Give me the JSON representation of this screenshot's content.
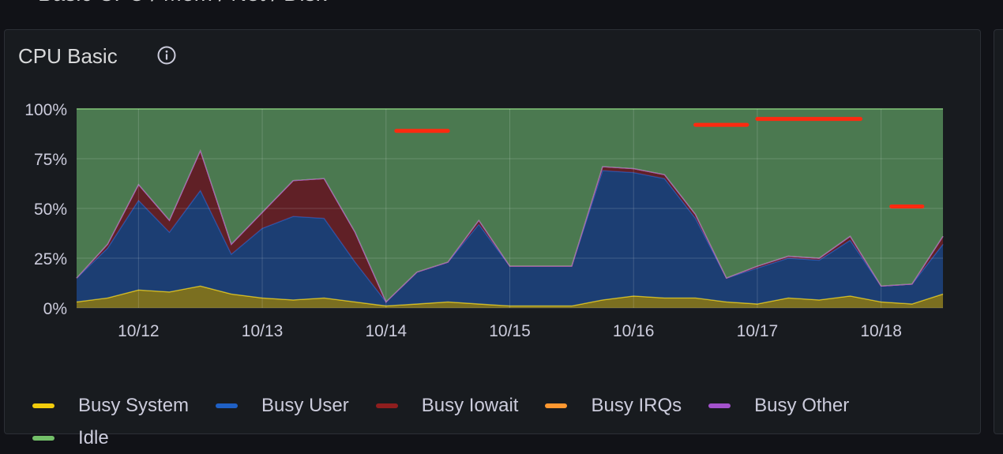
{
  "dashboard": {
    "row_title": "Basic CPU / Mem / Net / Disk"
  },
  "panel": {
    "title": "CPU Basic",
    "info_icon": "info-circle-icon"
  },
  "chart_data": {
    "type": "area",
    "stacked": true,
    "y_unit": "percent",
    "ylim": [
      0,
      100
    ],
    "yticks": [
      "0%",
      "25%",
      "50%",
      "75%",
      "100%"
    ],
    "xticks": [
      "10/12",
      "10/13",
      "10/14",
      "10/15",
      "10/16",
      "10/17",
      "10/18"
    ],
    "grid": true,
    "legend_placement": "bottom",
    "colors": {
      "busy_system": "#f2cc0c",
      "busy_user": "#1f60c4",
      "busy_iowait": "#8f1e1e",
      "busy_irqs": "#ff9830",
      "busy_other": "#a352cc",
      "idle": "#73bf69",
      "annotation_marks": "#ff2a10"
    },
    "x": [
      "10/11 12:00",
      "10/11 18:00",
      "10/12 00:00",
      "10/12 06:00",
      "10/12 12:00",
      "10/12 18:00",
      "10/13 00:00",
      "10/13 06:00",
      "10/13 12:00",
      "10/13 18:00",
      "10/14 00:00",
      "10/14 06:00",
      "10/14 12:00",
      "10/14 18:00",
      "10/15 00:00",
      "10/15 06:00",
      "10/15 12:00",
      "10/15 18:00",
      "10/16 00:00",
      "10/16 06:00",
      "10/16 12:00",
      "10/16 18:00",
      "10/17 00:00",
      "10/17 06:00",
      "10/17 12:00",
      "10/17 18:00",
      "10/18 00:00",
      "10/18 06:00",
      "10/18 12:00"
    ],
    "series": [
      {
        "name": "Busy System",
        "values": [
          3,
          5,
          9,
          8,
          11,
          7,
          5,
          4,
          5,
          3,
          1,
          2,
          3,
          2,
          1,
          1,
          1,
          4,
          6,
          5,
          5,
          3,
          2,
          5,
          4,
          6,
          3,
          2,
          7
        ]
      },
      {
        "name": "Busy User",
        "values": [
          12,
          25,
          45,
          30,
          48,
          20,
          35,
          42,
          40,
          20,
          2,
          16,
          20,
          40,
          20,
          20,
          20,
          65,
          62,
          60,
          40,
          12,
          18,
          20,
          20,
          28,
          8,
          10,
          25
        ]
      },
      {
        "name": "Busy Iowait",
        "values": [
          0,
          2,
          8,
          6,
          20,
          5,
          8,
          18,
          20,
          15,
          0,
          0,
          0,
          2,
          0,
          0,
          0,
          2,
          2,
          2,
          2,
          0,
          1,
          1,
          1,
          2,
          0,
          0,
          4
        ]
      },
      {
        "name": "Busy IRQs",
        "values": [
          0,
          0,
          0,
          0,
          0,
          0,
          0,
          0,
          0,
          0,
          0,
          0,
          0,
          0,
          0,
          0,
          0,
          0,
          0,
          0,
          0,
          0,
          0,
          0,
          0,
          0,
          0,
          0,
          0
        ]
      },
      {
        "name": "Busy Other",
        "values": [
          0,
          0,
          0,
          0,
          0,
          0,
          0,
          0,
          0,
          0,
          0,
          0,
          0,
          0,
          0,
          0,
          0,
          0,
          0,
          0,
          0,
          0,
          0,
          0,
          0,
          0,
          0,
          0,
          0
        ]
      },
      {
        "name": "Idle",
        "values": [
          85,
          68,
          38,
          56,
          21,
          68,
          52,
          36,
          35,
          62,
          97,
          82,
          77,
          56,
          79,
          79,
          79,
          29,
          30,
          33,
          53,
          85,
          79,
          74,
          75,
          64,
          89,
          88,
          64
        ]
      }
    ],
    "annotations": [
      {
        "type": "marker",
        "x0": "10/14 02:00",
        "x1": "10/14 12:00",
        "y": 89
      },
      {
        "type": "marker",
        "x0": "10/16 12:00",
        "x1": "10/16 22:00",
        "y": 92
      },
      {
        "type": "marker",
        "x0": "10/17 00:00",
        "x1": "10/17 20:00",
        "y": 95
      },
      {
        "type": "marker",
        "x0": "10/18 02:00",
        "x1": "10/18 08:00",
        "y": 51
      }
    ]
  },
  "legend": {
    "items": [
      {
        "label": "Busy System",
        "color": "#f2cc0c"
      },
      {
        "label": "Busy User",
        "color": "#1f60c4"
      },
      {
        "label": "Busy Iowait",
        "color": "#8f1e1e"
      },
      {
        "label": "Busy IRQs",
        "color": "#ff9830"
      },
      {
        "label": "Busy Other",
        "color": "#a352cc"
      },
      {
        "label": "Idle",
        "color": "#73bf69"
      }
    ]
  }
}
